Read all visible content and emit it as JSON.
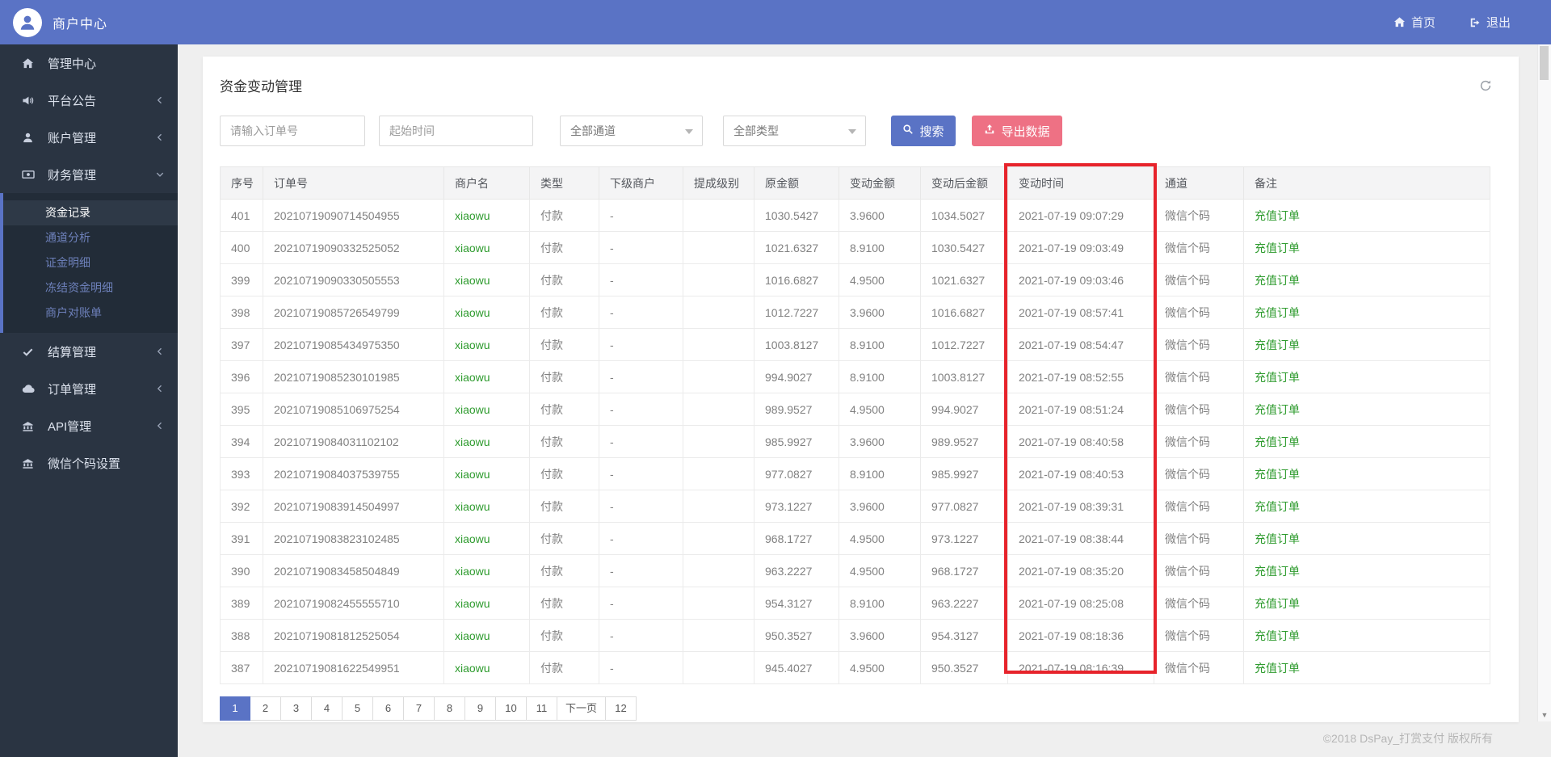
{
  "topbar": {
    "brand": "商户中心",
    "home_label": "首页",
    "logout_label": "退出"
  },
  "sidebar": {
    "items": [
      {
        "id": "dashboard",
        "label": "管理中心",
        "icon": "home-icon",
        "chevron": "none"
      },
      {
        "id": "announcements",
        "label": "平台公告",
        "icon": "volume-icon",
        "chevron": "left"
      },
      {
        "id": "accounts",
        "label": "账户管理",
        "icon": "user-icon",
        "chevron": "left"
      },
      {
        "id": "finance",
        "label": "财务管理",
        "icon": "money-icon",
        "chevron": "down",
        "expanded": true,
        "children": [
          {
            "label": "资金记录",
            "active": true
          },
          {
            "label": "通道分析",
            "active": false
          },
          {
            "label": "证金明细",
            "active": false
          },
          {
            "label": "冻结资金明细",
            "active": false
          },
          {
            "label": "商户对账单",
            "active": false
          }
        ]
      },
      {
        "id": "settlement",
        "label": "结算管理",
        "icon": "check-icon",
        "chevron": "left"
      },
      {
        "id": "orders",
        "label": "订单管理",
        "icon": "cloud-icon",
        "chevron": "left"
      },
      {
        "id": "api",
        "label": "API管理",
        "icon": "bank-icon",
        "chevron": "left"
      },
      {
        "id": "wechat-code",
        "label": "微信个码设置",
        "icon": "bank-icon",
        "chevron": "none"
      }
    ]
  },
  "page": {
    "title": "资金变动管理",
    "filters": {
      "order_placeholder": "请输入订单号",
      "time_placeholder": "起始时间",
      "channel_selected": "全部通道",
      "type_selected": "全部类型",
      "search_label": "搜索",
      "export_label": "导出数据"
    },
    "table": {
      "headers": [
        "序号",
        "订单号",
        "商户名",
        "类型",
        "下级商户",
        "提成级别",
        "原金额",
        "变动金额",
        "变动后金额",
        "变动时间",
        "通道",
        "备注"
      ],
      "green_columns": [
        2,
        11
      ],
      "rows": [
        [
          "401",
          "20210719090714504955",
          "xiaowu",
          "付款",
          "-",
          "",
          "1030.5427",
          "3.9600",
          "1034.5027",
          "2021-07-19 09:07:29",
          "微信个码",
          "充值订单"
        ],
        [
          "400",
          "20210719090332525052",
          "xiaowu",
          "付款",
          "-",
          "",
          "1021.6327",
          "8.9100",
          "1030.5427",
          "2021-07-19 09:03:49",
          "微信个码",
          "充值订单"
        ],
        [
          "399",
          "20210719090330505553",
          "xiaowu",
          "付款",
          "-",
          "",
          "1016.6827",
          "4.9500",
          "1021.6327",
          "2021-07-19 09:03:46",
          "微信个码",
          "充值订单"
        ],
        [
          "398",
          "20210719085726549799",
          "xiaowu",
          "付款",
          "-",
          "",
          "1012.7227",
          "3.9600",
          "1016.6827",
          "2021-07-19 08:57:41",
          "微信个码",
          "充值订单"
        ],
        [
          "397",
          "20210719085434975350",
          "xiaowu",
          "付款",
          "-",
          "",
          "1003.8127",
          "8.9100",
          "1012.7227",
          "2021-07-19 08:54:47",
          "微信个码",
          "充值订单"
        ],
        [
          "396",
          "20210719085230101985",
          "xiaowu",
          "付款",
          "-",
          "",
          "994.9027",
          "8.9100",
          "1003.8127",
          "2021-07-19 08:52:55",
          "微信个码",
          "充值订单"
        ],
        [
          "395",
          "20210719085106975254",
          "xiaowu",
          "付款",
          "-",
          "",
          "989.9527",
          "4.9500",
          "994.9027",
          "2021-07-19 08:51:24",
          "微信个码",
          "充值订单"
        ],
        [
          "394",
          "20210719084031102102",
          "xiaowu",
          "付款",
          "-",
          "",
          "985.9927",
          "3.9600",
          "989.9527",
          "2021-07-19 08:40:58",
          "微信个码",
          "充值订单"
        ],
        [
          "393",
          "20210719084037539755",
          "xiaowu",
          "付款",
          "-",
          "",
          "977.0827",
          "8.9100",
          "985.9927",
          "2021-07-19 08:40:53",
          "微信个码",
          "充值订单"
        ],
        [
          "392",
          "20210719083914504997",
          "xiaowu",
          "付款",
          "-",
          "",
          "973.1227",
          "3.9600",
          "977.0827",
          "2021-07-19 08:39:31",
          "微信个码",
          "充值订单"
        ],
        [
          "391",
          "20210719083823102485",
          "xiaowu",
          "付款",
          "-",
          "",
          "968.1727",
          "4.9500",
          "973.1227",
          "2021-07-19 08:38:44",
          "微信个码",
          "充值订单"
        ],
        [
          "390",
          "20210719083458504849",
          "xiaowu",
          "付款",
          "-",
          "",
          "963.2227",
          "4.9500",
          "968.1727",
          "2021-07-19 08:35:20",
          "微信个码",
          "充值订单"
        ],
        [
          "389",
          "20210719082455555710",
          "xiaowu",
          "付款",
          "-",
          "",
          "954.3127",
          "8.9100",
          "963.2227",
          "2021-07-19 08:25:08",
          "微信个码",
          "充值订单"
        ],
        [
          "388",
          "20210719081812525054",
          "xiaowu",
          "付款",
          "-",
          "",
          "950.3527",
          "3.9600",
          "954.3127",
          "2021-07-19 08:18:36",
          "微信个码",
          "充值订单"
        ],
        [
          "387",
          "20210719081622549951",
          "xiaowu",
          "付款",
          "-",
          "",
          "945.4027",
          "4.9500",
          "950.3527",
          "2021-07-19 08:16:39",
          "微信个码",
          "充值订单"
        ]
      ]
    },
    "pagination": [
      {
        "label": "1",
        "active": true
      },
      {
        "label": "2",
        "active": false
      },
      {
        "label": "3",
        "active": false
      },
      {
        "label": "4",
        "active": false
      },
      {
        "label": "5",
        "active": false
      },
      {
        "label": "6",
        "active": false
      },
      {
        "label": "7",
        "active": false
      },
      {
        "label": "8",
        "active": false
      },
      {
        "label": "9",
        "active": false
      },
      {
        "label": "10",
        "active": false
      },
      {
        "label": "11",
        "active": false
      },
      {
        "label": "下一页",
        "active": false
      },
      {
        "label": "12",
        "active": false
      }
    ],
    "footer": "©2018 DsPay_打赏支付 版权所有"
  },
  "colors": {
    "accent_blue": "#5a73c5",
    "export_pink": "#ee7184",
    "sidebar_dark": "#2a3442",
    "submenu_dark": "#222c38",
    "green_text": "#2e9b2e",
    "annotation_red": "#e7232b",
    "header_gray": "#f4f4f5",
    "content_bg": "#efefef"
  }
}
